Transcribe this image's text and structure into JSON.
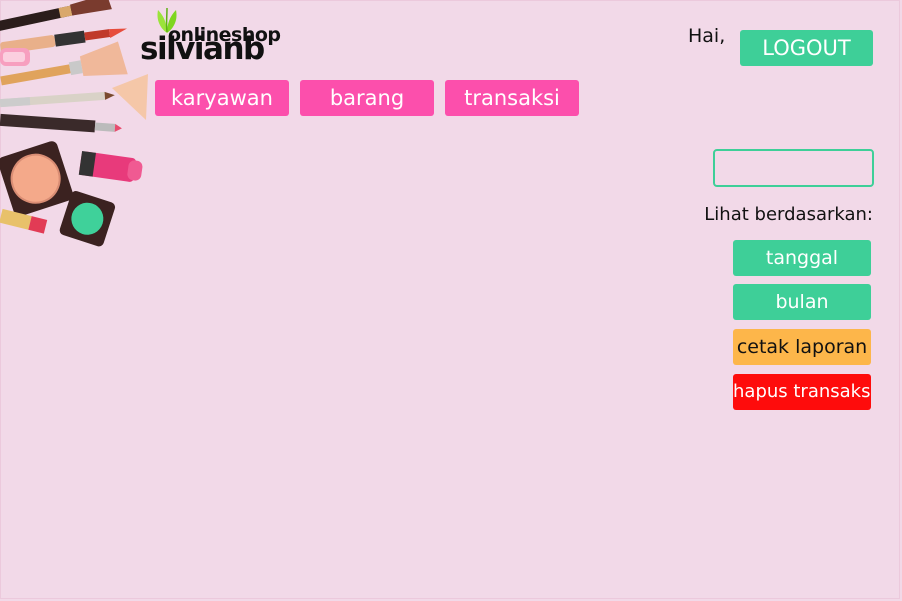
{
  "brand": {
    "online_text": "onlineshop",
    "main_text": "silvianb"
  },
  "nav": {
    "items": [
      {
        "label": "karyawan"
      },
      {
        "label": "barang"
      },
      {
        "label": "transaksi"
      }
    ]
  },
  "header": {
    "greeting": "Hai,",
    "logout_label": "LOGOUT"
  },
  "search": {
    "value": "",
    "placeholder": ""
  },
  "filter": {
    "title": "Lihat berdasarkan:",
    "date_label": "tanggal",
    "month_label": "bulan"
  },
  "actions": {
    "print_label": "cetak laporan",
    "delete_label": "hapus transaksi"
  },
  "colors": {
    "background": "#f2d9e8",
    "nav": "#fc4fac",
    "green": "#3ecf98",
    "orange": "#fdb64a",
    "red": "#fe0c0c"
  },
  "decor": {
    "illustration": "makeup-brushes-lipstick-compact-illustration"
  }
}
